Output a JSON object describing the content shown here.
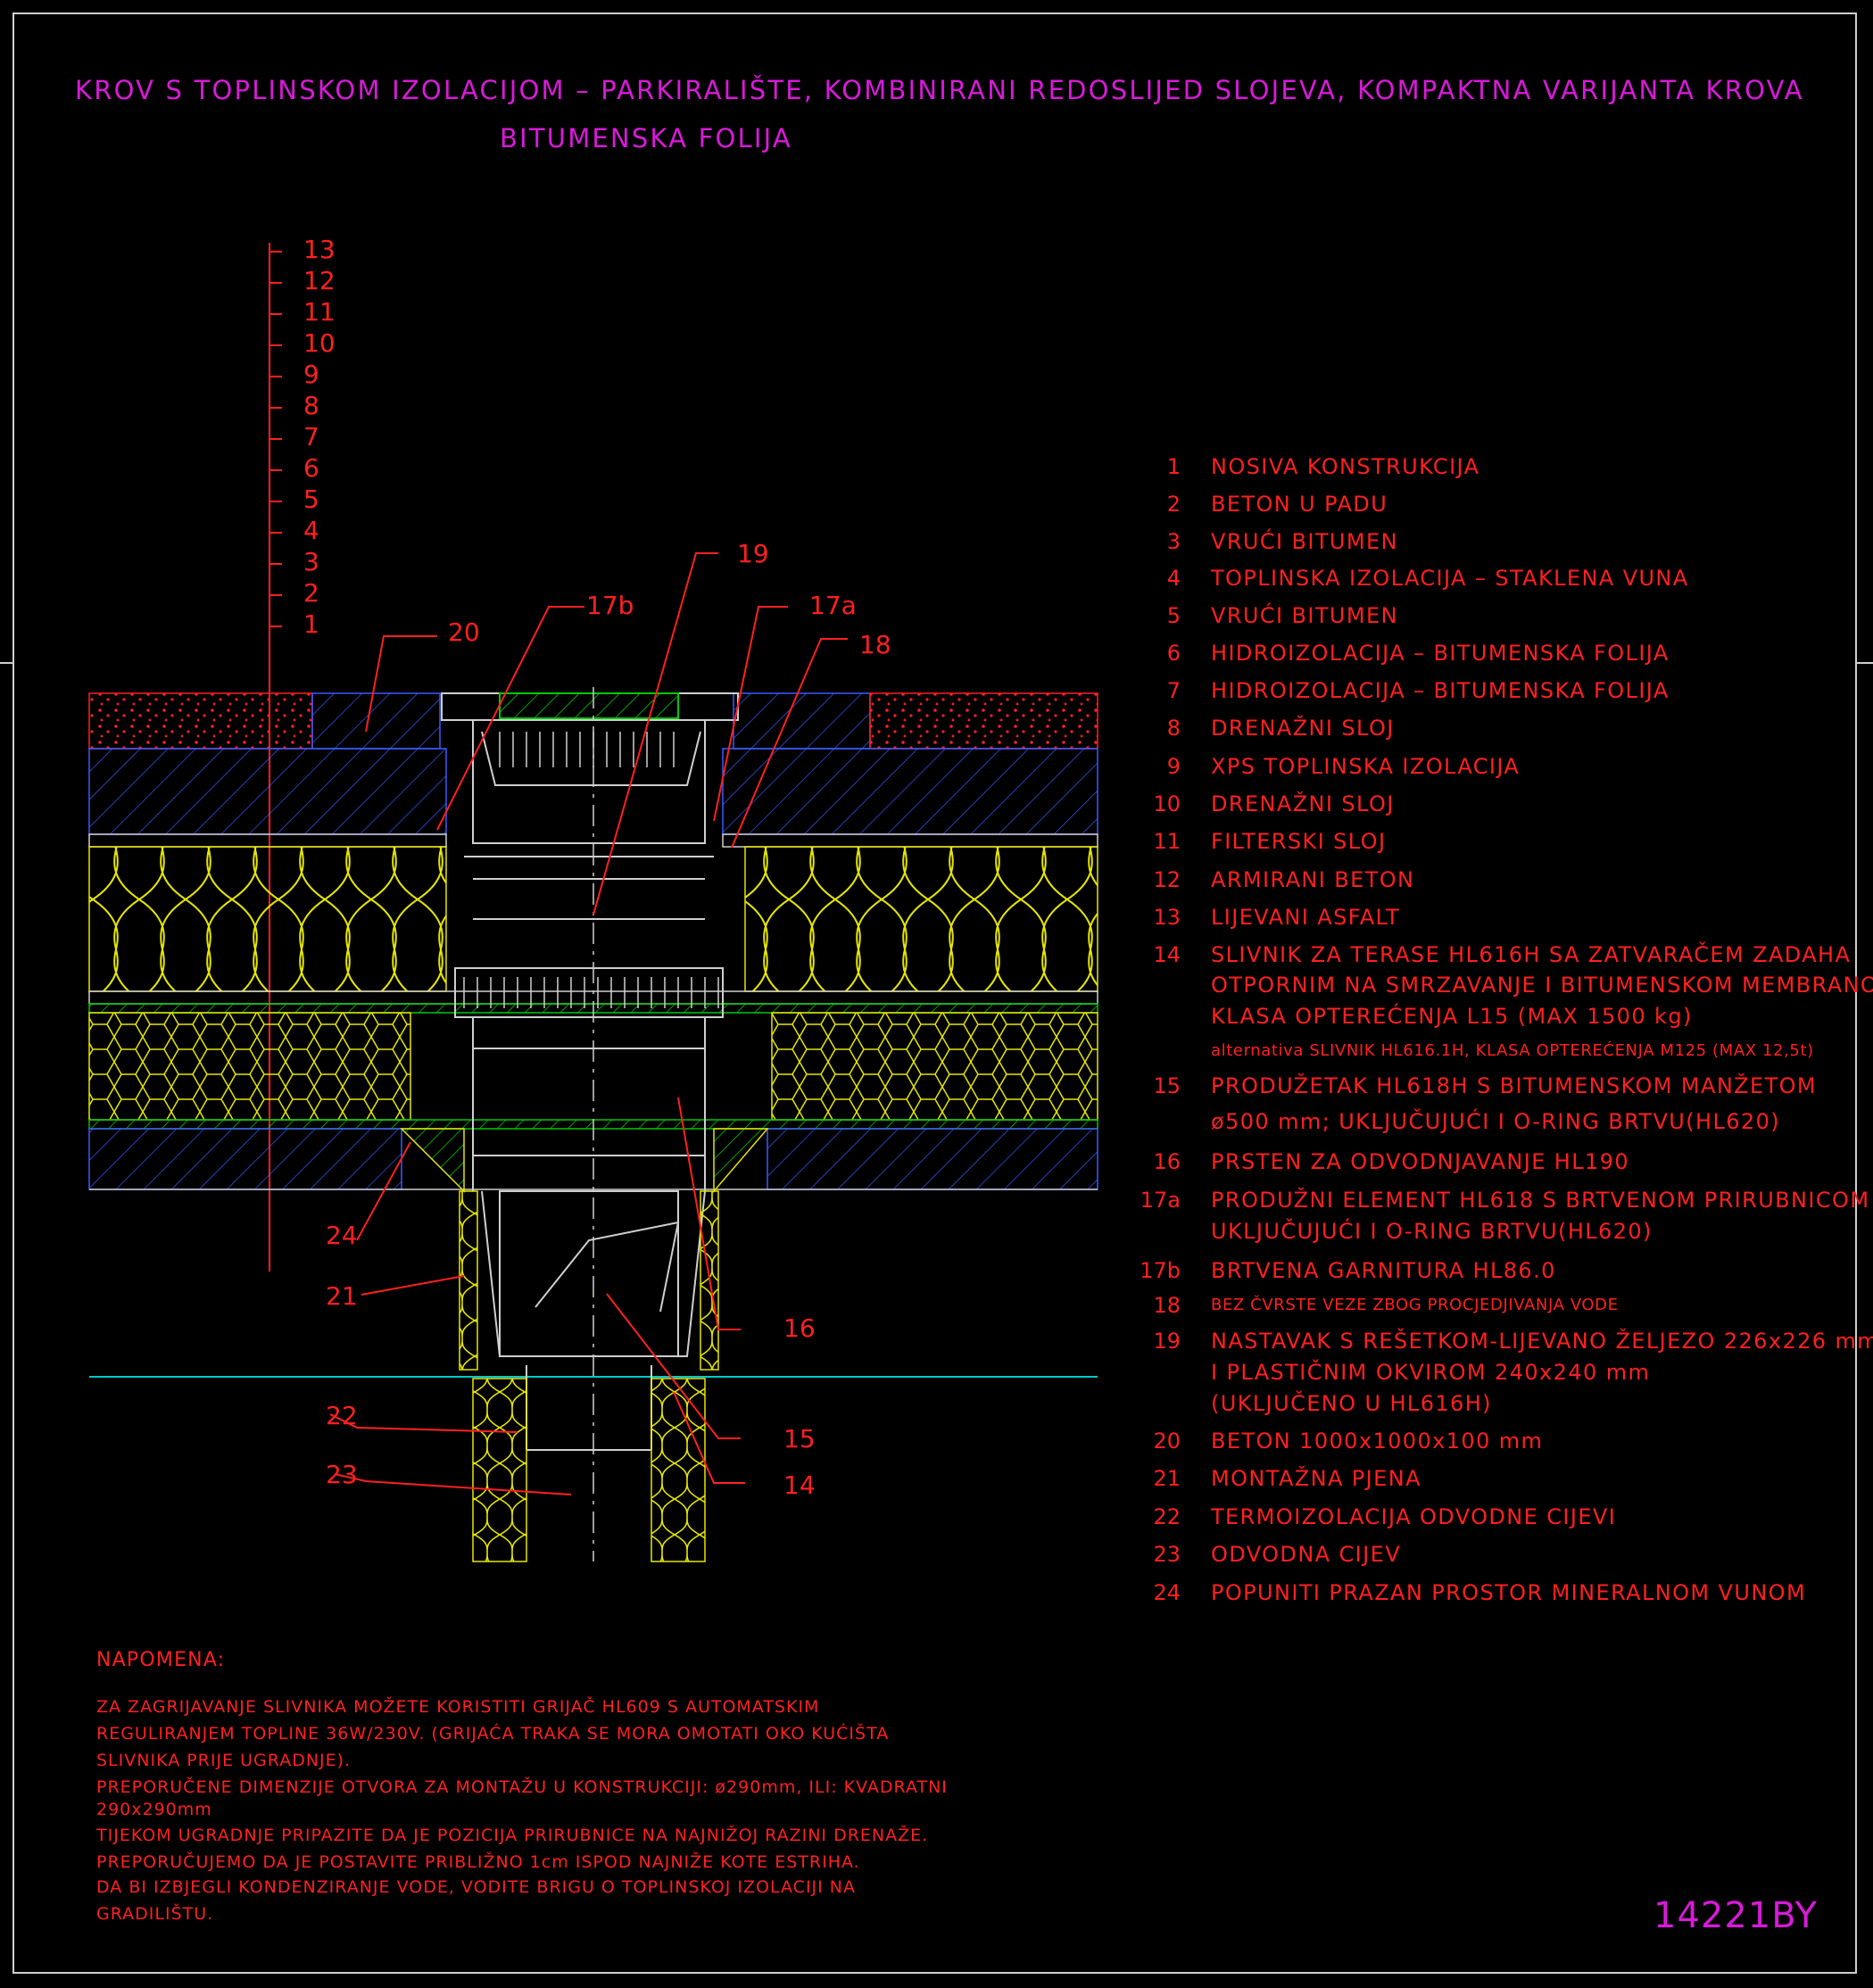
{
  "title": {
    "line1": "KROV S TOPLINSKOM IZOLACIJOM – PARKIRALIŠTE, KOMBINIRANI REDOSLIJED SLOJEVA, KOMPAKTNA VARIJANTA KROVA",
    "line2": "BITUMENSKA FOLIJA"
  },
  "scale_numbers": [
    "13",
    "12",
    "11",
    "10",
    "9",
    "8",
    "7",
    "6",
    "5",
    "4",
    "3",
    "2",
    "1"
  ],
  "callouts": [
    "20",
    "17b",
    "17a",
    "18",
    "19",
    "24",
    "21",
    "16",
    "22",
    "23",
    "15",
    "14"
  ],
  "legend": [
    {
      "num": "1",
      "lines": [
        "NOSIVA KONSTRUKCIJA"
      ]
    },
    {
      "num": "2",
      "lines": [
        "BETON U PADU"
      ]
    },
    {
      "num": "3",
      "lines": [
        "VRUĆI BITUMEN"
      ]
    },
    {
      "num": "4",
      "lines": [
        "TOPLINSKA IZOLACIJA – STAKLENA VUNA"
      ]
    },
    {
      "num": "5",
      "lines": [
        "VRUĆI BITUMEN"
      ]
    },
    {
      "num": "6",
      "lines": [
        "HIDROIZOLACIJA – BITUMENSKA FOLIJA"
      ]
    },
    {
      "num": "7",
      "lines": [
        "HIDROIZOLACIJA – BITUMENSKA FOLIJA"
      ]
    },
    {
      "num": "8",
      "lines": [
        "DRENAŽNI SLOJ"
      ]
    },
    {
      "num": "9",
      "lines": [
        "XPS TOPLINSKA IZOLACIJA"
      ]
    },
    {
      "num": "10",
      "lines": [
        "DRENAŽNI SLOJ"
      ]
    },
    {
      "num": "11",
      "lines": [
        "FILTERSKI SLOJ"
      ]
    },
    {
      "num": "12",
      "lines": [
        "ARMIRANI BETON"
      ]
    },
    {
      "num": "13",
      "lines": [
        "LIJEVANI ASFALT"
      ]
    },
    {
      "num": "14",
      "lines": [
        "SLIVNIK ZA TERASE HL616H SA ZATVARAČEM ZADAHA",
        "OTPORNIM NA SMRZAVANJE I BITUMENSKOM MEMBRANOM",
        "KLASA OPTEREĆENJA L15 (MAX 1500 kg)"
      ],
      "small": "alternativa SLIVNIK HL616.1H, KLASA OPTEREĆENJA M125 (MAX 12,5t)"
    },
    {
      "num": "15",
      "lines": [
        "PRODUŽETAK HL618H S BITUMENSKOM MANŽETOM",
        "ø500 mm; UKLJUČUJUĆI I O-RING BRTVU(HL620)"
      ]
    },
    {
      "num": "16",
      "lines": [
        "PRSTEN ZA ODVODNJAVANJE HL190"
      ]
    },
    {
      "num": "17a",
      "lines": [
        "PRODUŽNI ELEMENT HL618 S BRTVENOM PRIRUBNICOM",
        "UKLJUČUJUĆI I O-RING BRTVU(HL620)"
      ]
    },
    {
      "num": "17b",
      "lines": [
        "BRTVENA GARNITURA HL86.0"
      ]
    },
    {
      "num": "18",
      "lines": [
        "BEZ ČVRSTE VEZE ZBOG PROCJEDJIVANJA VODE"
      ],
      "small_main": true
    },
    {
      "num": "19",
      "lines": [
        "NASTAVAK S REŠETKOM-LIJEVANO ŽELJEZO 226x226 mm",
        "I PLASTIČNIM OKVIROM 240x240 mm",
        "(UKLJUČENO U   HL616H)"
      ]
    },
    {
      "num": "20",
      "lines": [
        "BETON 1000x1000x100 mm"
      ]
    },
    {
      "num": "21",
      "lines": [
        "MONTAŽNA PJENA"
      ]
    },
    {
      "num": "22",
      "lines": [
        "TERMOIZOLACIJA ODVODNE CIJEVI"
      ]
    },
    {
      "num": "23",
      "lines": [
        "ODVODNA CIJEV"
      ]
    },
    {
      "num": "24",
      "lines": [
        "POPUNITI PRAZAN PROSTOR MINERALNOM VUNOM"
      ]
    }
  ],
  "note": {
    "title": "NAPOMENA:",
    "lines": [
      "ZA ZAGRIJAVANJE SLIVNIKA MOŽETE KORISTITI GRIJAČ HL609 S AUTOMATSKIM",
      "REGULIRANJEM TOPLINE 36W/230V. (GRIJAĆA TRAKA SE MORA OMOTATI OKO KUĆIŠTA",
      "SLIVNIKA PRIJE UGRADNJE).",
      "PREPORUČENE DIMENZIJE OTVORA ZA MONTAŽU U KONSTRUKCIJI: ø290mm, ILI: KVADRATNI",
      "290x290mm",
      "TIJEKOM UGRADNJE PRIPAZITE DA JE POZICIJA PRIRUBNICE NA NAJNIŽOJ RAZINI DRENAŽE.",
      "PREPORUČUJEMO DA JE POSTAVITE PRIBLIŽNO 1cm ISPOD NAJNIŽE KOTE ESTRIHA.",
      "DA BI IZBJEGLI KONDENZIRANJE VODE, VODITE BRIGU O TOPLINSKOJ IZOLACIJI NA",
      "GRADILIŠTU."
    ]
  },
  "drawing_code": "14221BY",
  "colors": {
    "background": "#000000",
    "text": "#ff2020",
    "title": "#d81ad8",
    "insulation": "#e6e600",
    "membrane": "#00c800",
    "xps": "#3b5bff",
    "concrete": "#ff2020",
    "cyan": "#00c8c8",
    "frame": "#cfcfcf"
  }
}
